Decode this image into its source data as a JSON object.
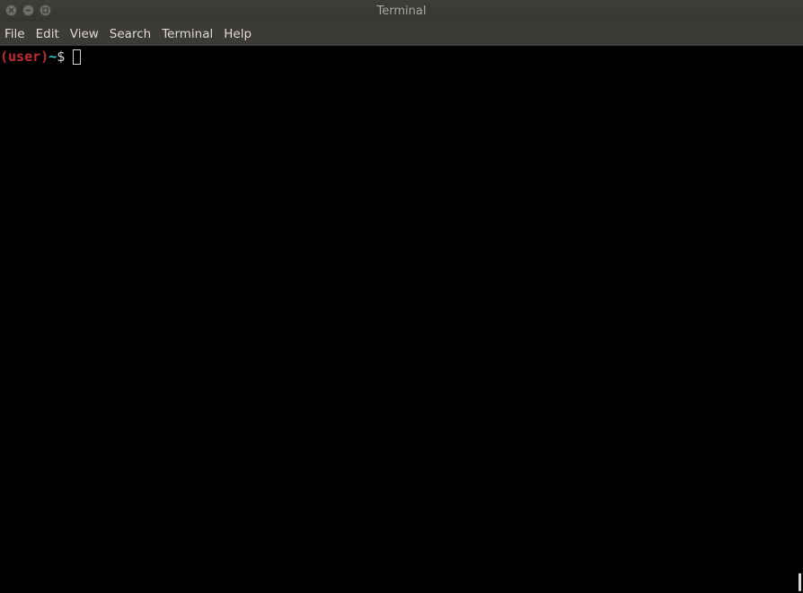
{
  "window": {
    "title": "Terminal",
    "controls": [
      "close-icon",
      "minimize-icon",
      "maximize-icon"
    ]
  },
  "menu": {
    "items": [
      {
        "label": "File"
      },
      {
        "label": "Edit"
      },
      {
        "label": "View"
      },
      {
        "label": "Search"
      },
      {
        "label": "Terminal"
      },
      {
        "label": "Help"
      }
    ]
  },
  "terminal": {
    "prompt_user": "(user)",
    "prompt_tilde": "~",
    "prompt_dollar": "$",
    "colors": {
      "background": "#000000",
      "prompt_user": "#c42a35",
      "prompt_path": "#34c4c4",
      "foreground": "#d3d7cf"
    }
  }
}
